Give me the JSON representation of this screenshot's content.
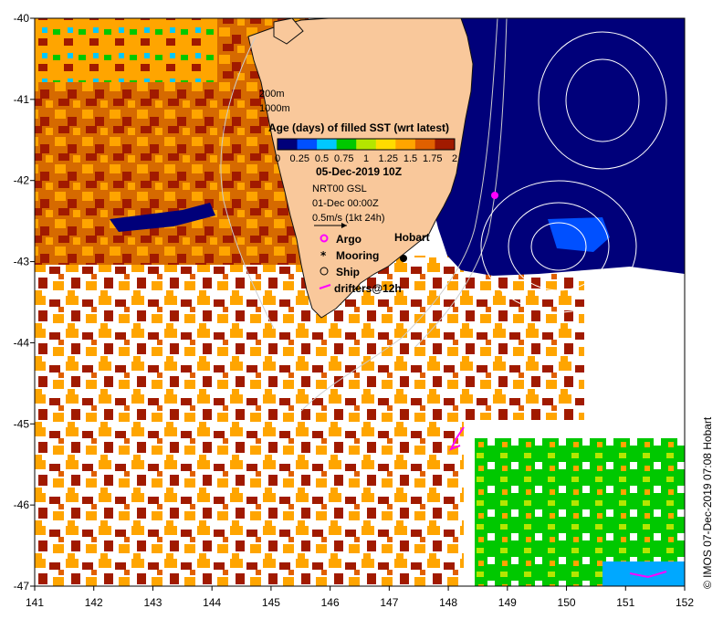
{
  "map": {
    "lon_ticks": [
      "141",
      "142",
      "143",
      "144",
      "145",
      "146",
      "147",
      "148",
      "149",
      "150",
      "151",
      "152"
    ],
    "lat_ticks": [
      "-40",
      "-41",
      "-42",
      "-43",
      "-44",
      "-45",
      "-46",
      "-47"
    ],
    "lon_range": [
      141,
      152
    ],
    "lat_range": [
      -47,
      -40
    ],
    "colors": {
      "land": "#f9c89b",
      "ocean_age_0": "#00007a",
      "ocean_age_1": "#ffa500",
      "ocean_age_2": "#a11a00",
      "missing": "#ffffff"
    }
  },
  "legend": {
    "depth_200": "200m",
    "depth_1000": "1000m",
    "title": "Age (days) of filled SST (wrt latest)",
    "colorbar_ticks": [
      "0",
      "0.25",
      "0.5",
      "0.75",
      "1",
      "1.25",
      "1.5",
      "1.75",
      "2"
    ],
    "colorbar_colors": [
      "#00007a",
      "#0050ff",
      "#00c8ff",
      "#00c800",
      "#b4e600",
      "#ffdc00",
      "#ffa500",
      "#e06000",
      "#a11a00"
    ],
    "date": "05-Dec-2019 10Z",
    "product": "NRT00 GSL",
    "current_time": "01-Dec 00:00Z",
    "scale_arrow": "0.5m/s (1kt 24h)",
    "symbols": {
      "argo": "Argo",
      "mooring": "Mooring",
      "ship": "Ship",
      "drifters": "drifters@12h"
    }
  },
  "places": {
    "hobart": "Hobart"
  },
  "credit": "© IMOS 07-Dec-2019 07:08 Hobart"
}
